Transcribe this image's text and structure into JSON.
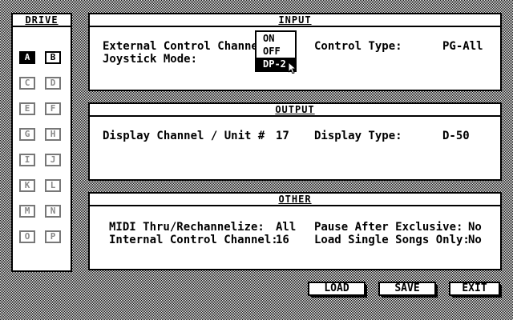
{
  "drive": {
    "title": "DRIVE",
    "buttons": [
      {
        "label": "A",
        "state": "selected"
      },
      {
        "label": "B",
        "state": "active"
      },
      {
        "label": "C",
        "state": "disabled"
      },
      {
        "label": "D",
        "state": "disabled"
      },
      {
        "label": "E",
        "state": "disabled"
      },
      {
        "label": "F",
        "state": "disabled"
      },
      {
        "label": "G",
        "state": "disabled"
      },
      {
        "label": "H",
        "state": "disabled"
      },
      {
        "label": "I",
        "state": "disabled"
      },
      {
        "label": "J",
        "state": "disabled"
      },
      {
        "label": "K",
        "state": "disabled"
      },
      {
        "label": "L",
        "state": "disabled"
      },
      {
        "label": "M",
        "state": "disabled"
      },
      {
        "label": "N",
        "state": "disabled"
      },
      {
        "label": "O",
        "state": "disabled"
      },
      {
        "label": "P",
        "state": "disabled"
      }
    ]
  },
  "input": {
    "title": "INPUT",
    "external_label": "External Control Channel",
    "joystick_label": "Joystick Mode:",
    "control_type_label": "Control Type:",
    "control_type_value": "PG-All",
    "dropdown_options": [
      "ON",
      "OFF",
      "DP-2"
    ],
    "dropdown_selected": "DP-2"
  },
  "output": {
    "title": "OUTPUT",
    "display_channel_label": "Display Channel / Unit #",
    "display_channel_value": "17",
    "display_type_label": "Display Type:",
    "display_type_value": "D-50"
  },
  "other": {
    "title": "OTHER",
    "midi_thru_label": "MIDI Thru/Rechannelize:",
    "midi_thru_value": "All",
    "internal_channel_label": "Internal Control Channel:",
    "internal_channel_value": "16",
    "pause_label": "Pause After Exclusive:",
    "pause_value": "No",
    "load_single_label": "Load Single Songs Only:",
    "load_single_value": "No"
  },
  "actions": {
    "load": "LOAD",
    "save": "SAVE",
    "exit": "EXIT"
  }
}
